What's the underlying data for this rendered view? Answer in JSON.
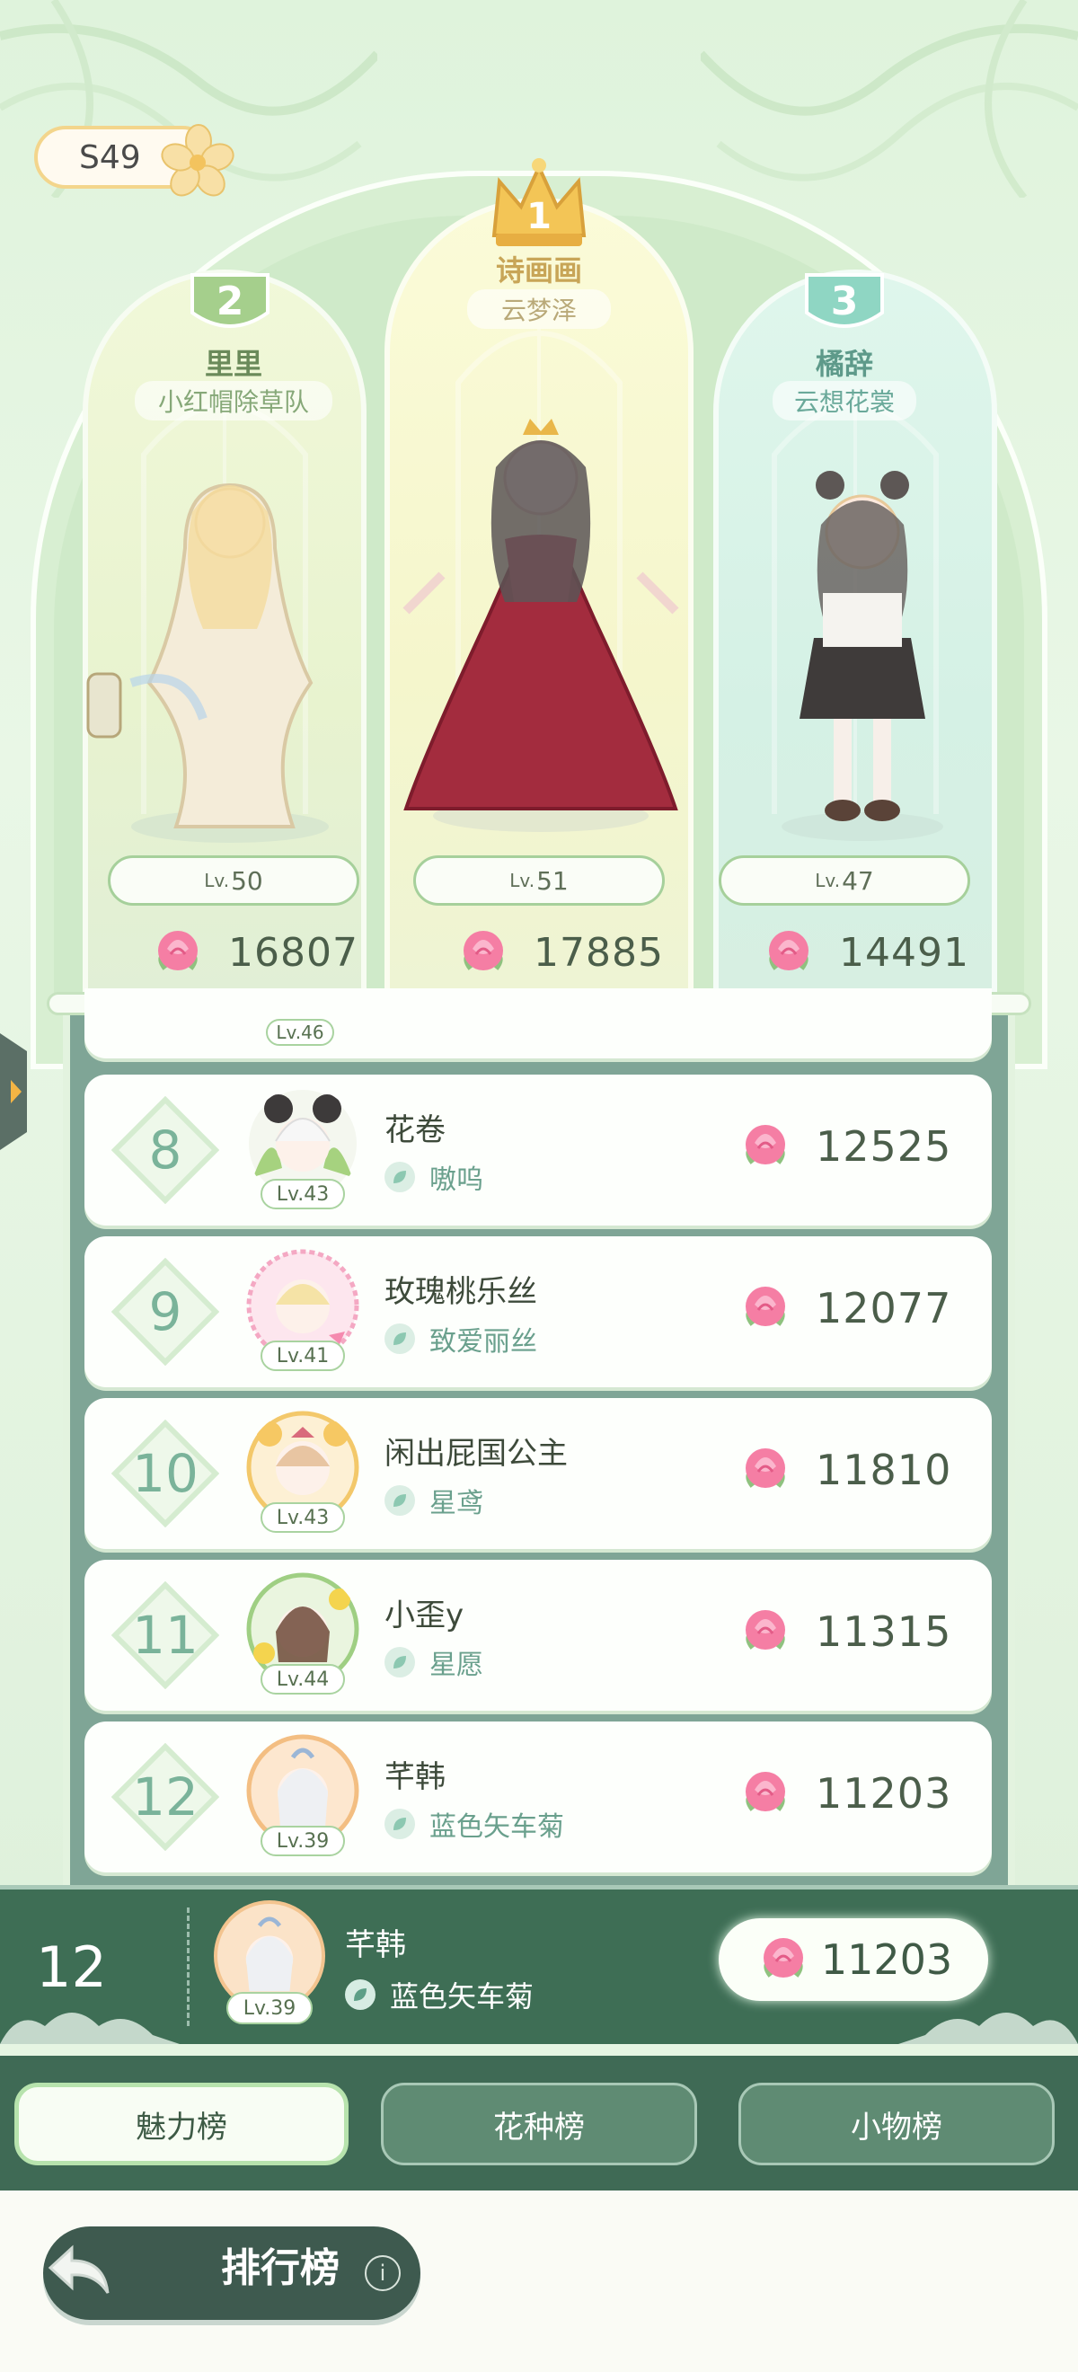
{
  "season": "S49",
  "top3": [
    {
      "rank": "2",
      "name": "里里",
      "team": "小红帽除草队",
      "level_prefix": "Lv.",
      "level": "50",
      "score": "16807"
    },
    {
      "rank": "1",
      "name": "诗画画",
      "team": "云梦泽",
      "level_prefix": "Lv.",
      "level": "51",
      "score": "17885"
    },
    {
      "rank": "3",
      "name": "橘辞",
      "team": "云想花裳",
      "level_prefix": "Lv.",
      "level": "47",
      "score": "14491"
    }
  ],
  "partial_row_level": "Lv.46",
  "rows": [
    {
      "rank": "8",
      "name": "花卷",
      "team": "嗷呜",
      "level": "Lv.43",
      "score": "12525"
    },
    {
      "rank": "9",
      "name": "玫瑰桃乐丝",
      "team": "致爱丽丝",
      "level": "Lv.41",
      "score": "12077"
    },
    {
      "rank": "10",
      "name": "闲出屁国公主",
      "team": "星鸢",
      "level": "Lv.43",
      "score": "11810"
    },
    {
      "rank": "11",
      "name": "小歪y",
      "team": "星愿",
      "level": "Lv.44",
      "score": "11315"
    },
    {
      "rank": "12",
      "name": "芊韩",
      "team": "蓝色矢车菊",
      "level": "Lv.39",
      "score": "11203"
    }
  ],
  "me": {
    "rank": "12",
    "name": "芊韩",
    "team": "蓝色矢车菊",
    "level": "Lv.39",
    "score": "11203"
  },
  "tabs": [
    "魅力榜",
    "花种榜",
    "小物榜"
  ],
  "footer_title": "排行榜",
  "info_glyph": "i",
  "colors": {
    "accent_green": "#3e6e55",
    "rose_pink": "#f06a96",
    "gold": "#e9b74a"
  }
}
